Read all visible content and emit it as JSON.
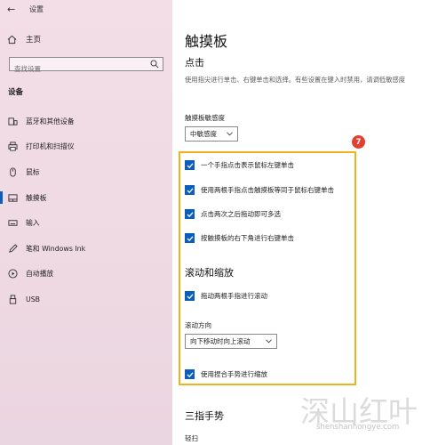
{
  "window": {
    "title": "设置"
  },
  "sidebar": {
    "home_label": "主页",
    "search_placeholder": "查找设置",
    "section_label": "设备",
    "items": [
      {
        "label": "蓝牙和其他设备",
        "icon": "bluetooth-icon"
      },
      {
        "label": "打印机和扫描仪",
        "icon": "printer-icon"
      },
      {
        "label": "鼠标",
        "icon": "mouse-icon"
      },
      {
        "label": "触摸板",
        "icon": "touchpad-icon",
        "active": true
      },
      {
        "label": "输入",
        "icon": "keyboard-icon"
      },
      {
        "label": "笔和 Windows Ink",
        "icon": "pen-icon"
      },
      {
        "label": "自动播放",
        "icon": "autoplay-icon"
      },
      {
        "label": "USB",
        "icon": "usb-icon"
      }
    ]
  },
  "main": {
    "title": "触摸板",
    "tap_heading": "点击",
    "tap_description": "使用指尖进行单击、右键单击和选择。有些设置在键入时禁用，请调低敏感度",
    "sensitivity_label": "触摸板敏感度",
    "sensitivity_value": "中敏感度",
    "badge": "7",
    "tap_checkboxes": [
      {
        "label": "一个手指点击表示鼠标左键单击",
        "checked": true
      },
      {
        "label": "使用两根手指点击触摸板等同于鼠标右键单击",
        "checked": true
      },
      {
        "label": "点击两次之后拖动即可多选",
        "checked": true
      },
      {
        "label": "按触摸板的右下角进行右键单击",
        "checked": true
      }
    ],
    "scroll_heading": "滚动和缩放",
    "scroll_checkbox": {
      "label": "拖动两根手指进行滚动",
      "checked": true
    },
    "scroll_direction_label": "滚动方向",
    "scroll_direction_value": "向下移动时向上滚动",
    "zoom_checkbox": {
      "label": "使用捏合手势进行缩放",
      "checked": true
    },
    "three_finger_heading": "三指手势",
    "swipe_label": "轻扫"
  },
  "watermark": {
    "cn": "深山红叶",
    "en": "shenshanhongye.com"
  },
  "colors": {
    "accent": "#0a5fbd",
    "highlight_border": "#f0b21a",
    "badge": "#e23f31"
  }
}
